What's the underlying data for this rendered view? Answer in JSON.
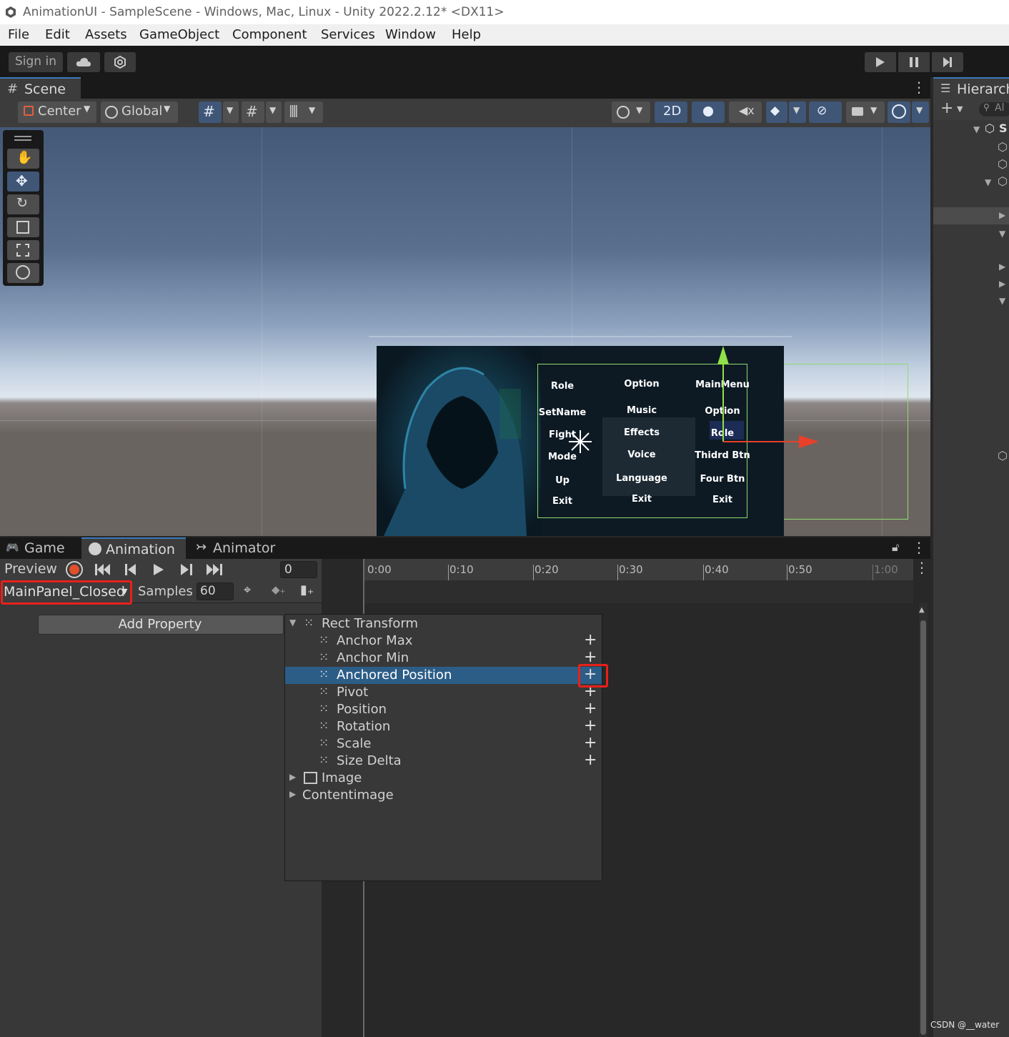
{
  "window": {
    "title": "AnimationUI - SampleScene - Windows, Mac, Linux - Unity 2022.2.12* <DX11>"
  },
  "menu": [
    "File",
    "Edit",
    "Assets",
    "GameObject",
    "Component",
    "Services",
    "Window",
    "Help"
  ],
  "toolbar": {
    "signin": "Sign in"
  },
  "scene": {
    "tab": "Scene",
    "pivot": "Center",
    "space": "Global",
    "mode_2d": "2D"
  },
  "ui_panel": {
    "col1": [
      "Role",
      "SetName",
      "Fight",
      "Mode",
      "Up",
      "Exit"
    ],
    "col2": [
      "Option",
      "Music",
      "Effects",
      "Voice",
      "Language",
      "Exit"
    ],
    "col3": [
      "MainMenu",
      "Option",
      "Role",
      "Thidrd Btn",
      "Four Btn",
      "Exit"
    ]
  },
  "hierarchy": {
    "tab": "Hierarch",
    "search_hint": "Al"
  },
  "animation": {
    "tabs": {
      "game": "Game",
      "animation": "Animation",
      "animator": "Animator"
    },
    "preview": "Preview",
    "frame": "0",
    "clip": "MainPanel_Closed",
    "samples_label": "Samples",
    "samples": "60",
    "add_property": "Add Property",
    "ruler": [
      "0:00",
      "0:10",
      "0:20",
      "0:30",
      "0:40",
      "0:50",
      "1:00"
    ]
  },
  "property_popup": {
    "group": "Rect Transform",
    "items": [
      "Anchor Max",
      "Anchor Min",
      "Anchored Position",
      "Pivot",
      "Position",
      "Rotation",
      "Scale",
      "Size Delta"
    ],
    "selected": "Anchored Position",
    "others": [
      "Image",
      "Contentimage"
    ]
  },
  "watermark": "CSDN @__water",
  "colors": {
    "accent": "#3a79bb",
    "selection": "#2c5d87",
    "highlight_box": "#e8211a",
    "record": "#e0502c"
  }
}
